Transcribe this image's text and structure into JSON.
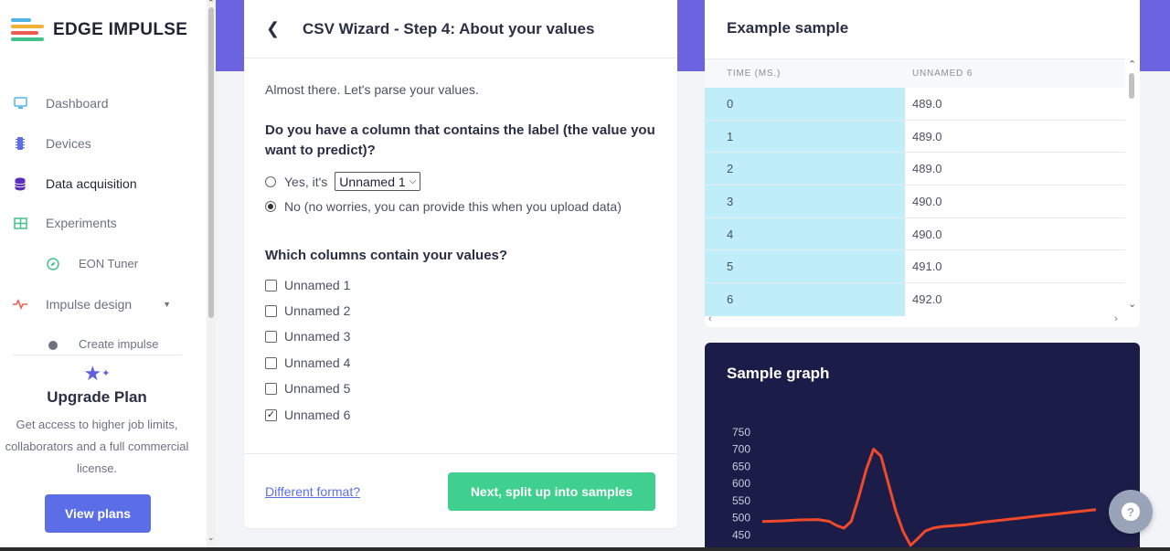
{
  "brand": {
    "name": "EDGE IMPULSE"
  },
  "sidebar": {
    "items": [
      {
        "label": "Dashboard",
        "icon": "monitor-icon"
      },
      {
        "label": "Devices",
        "icon": "chip-icon"
      },
      {
        "label": "Data acquisition",
        "icon": "database-icon",
        "active": true
      },
      {
        "label": "Experiments",
        "icon": "table-icon"
      },
      {
        "label": "EON Tuner",
        "icon": "compass-icon"
      },
      {
        "label": "Impulse design",
        "icon": "pulse-icon"
      },
      {
        "label": "Create impulse",
        "icon": "dot-icon"
      }
    ],
    "upgrade": {
      "title": "Upgrade Plan",
      "text": "Get access to higher job limits, collaborators and a full commercial license.",
      "button": "View plans"
    }
  },
  "wizard": {
    "title": "CSV Wizard - Step 4: About your values",
    "intro": "Almost there. Let's parse your values.",
    "question1": "Do you have a column that contains the label (the value you want to predict)?",
    "option_yes": "Yes, it's",
    "option_yes_select": "Unnamed 1",
    "option_no": "No (no worries, you can provide this when you upload data)",
    "question2": "Which columns contain your values?",
    "columns": [
      {
        "label": "Unnamed 1",
        "checked": false
      },
      {
        "label": "Unnamed 2",
        "checked": false
      },
      {
        "label": "Unnamed 3",
        "checked": false
      },
      {
        "label": "Unnamed 4",
        "checked": false
      },
      {
        "label": "Unnamed 5",
        "checked": false
      },
      {
        "label": "Unnamed 6",
        "checked": true
      }
    ],
    "different_format": "Different format?",
    "next_button": "Next, split up into samples"
  },
  "sample": {
    "title": "Example sample",
    "headers": [
      "TIME (MS.)",
      "UNNAMED 6"
    ],
    "rows": [
      [
        "0",
        "489.0"
      ],
      [
        "1",
        "489.0"
      ],
      [
        "2",
        "489.0"
      ],
      [
        "3",
        "490.0"
      ],
      [
        "4",
        "490.0"
      ],
      [
        "5",
        "491.0"
      ],
      [
        "6",
        "492.0"
      ]
    ]
  },
  "graph": {
    "title": "Sample graph",
    "chart_data": {
      "type": "line",
      "yticks": [
        750,
        700,
        650,
        600,
        550,
        500,
        450
      ],
      "ylim": [
        430,
        760
      ],
      "x": [
        0,
        5,
        10,
        15,
        18,
        20,
        22,
        24,
        26,
        28,
        30,
        32,
        34,
        36,
        38,
        40,
        42,
        44,
        46,
        48,
        50,
        55,
        60,
        65,
        70,
        75,
        80,
        85,
        90
      ],
      "series": [
        {
          "values": [
            489,
            491,
            494,
            495,
            490,
            478,
            470,
            490,
            560,
            640,
            700,
            680,
            600,
            520,
            460,
            420,
            440,
            462,
            470,
            474,
            476,
            480,
            488,
            494,
            500,
            506,
            512,
            518,
            524
          ],
          "color": "#f04a2a"
        }
      ]
    }
  },
  "help": {
    "label": "?"
  }
}
